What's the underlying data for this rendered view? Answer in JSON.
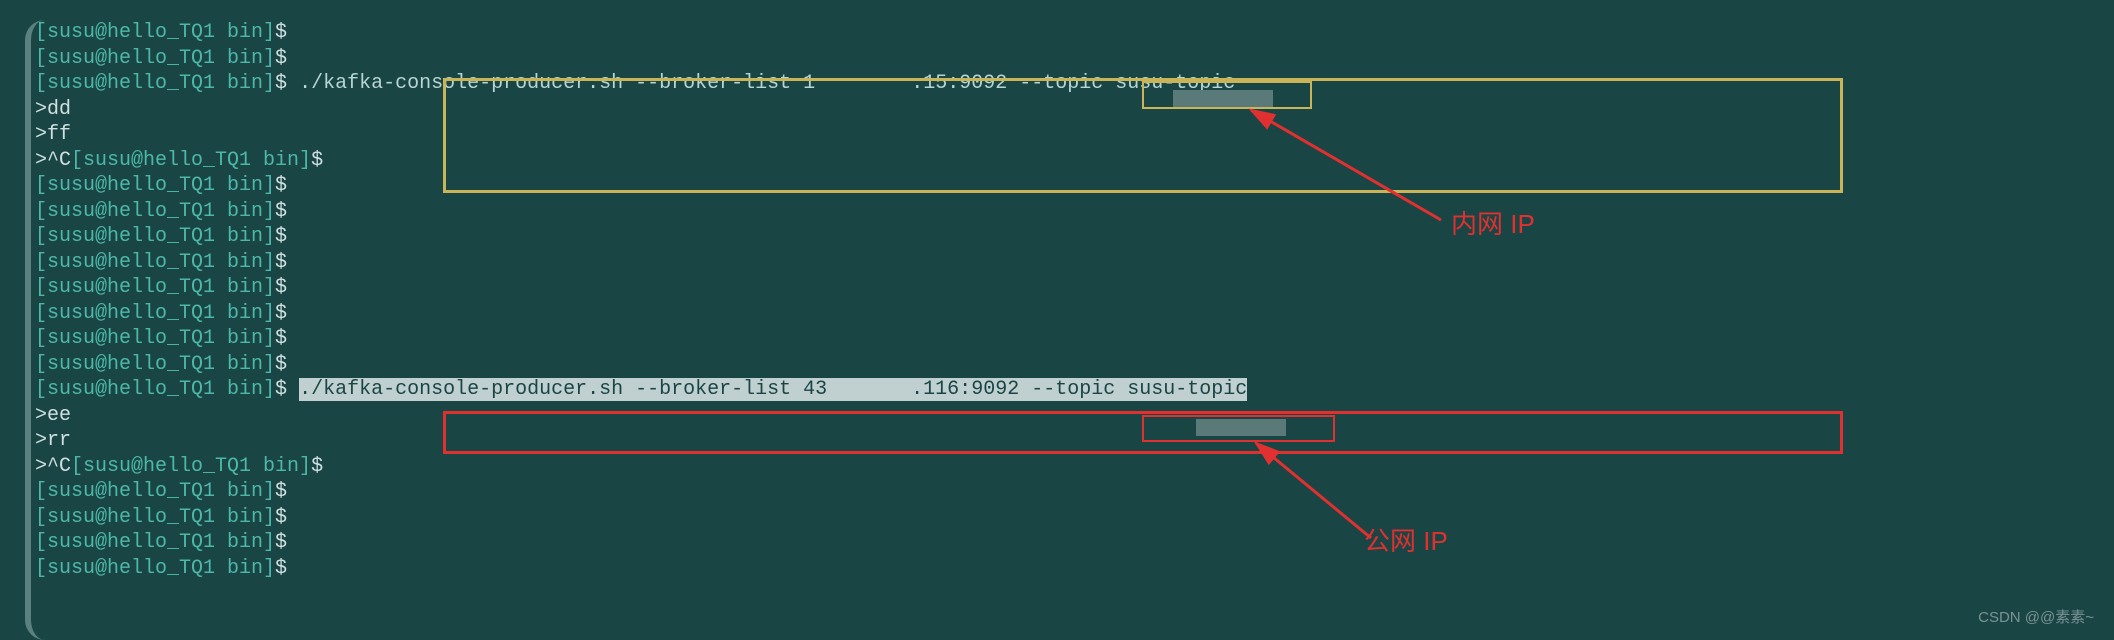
{
  "prompt": "[susu@hello_TQ1 bin]",
  "dollar": "$",
  "lines": {
    "l1": "",
    "l2": "",
    "cmd1_a": "./kafka-console-producer.sh --broker-list ",
    "cmd1_ip": "1        .15",
    "cmd1_b": ":9092 --topic susu-topic",
    "in1": ">dd",
    "in2": ">ff",
    "in3": ">^C",
    "cmd2_a": "./kafka-console-producer.sh --broker-list 43       .116:9092 --topic susu-topic",
    "in4": ">ee",
    "in5": ">rr",
    "in6": ">^C"
  },
  "annotations": {
    "inner_ip": "内网 IP",
    "public_ip": "公网 IP"
  },
  "watermark": "CSDN @@素素~"
}
